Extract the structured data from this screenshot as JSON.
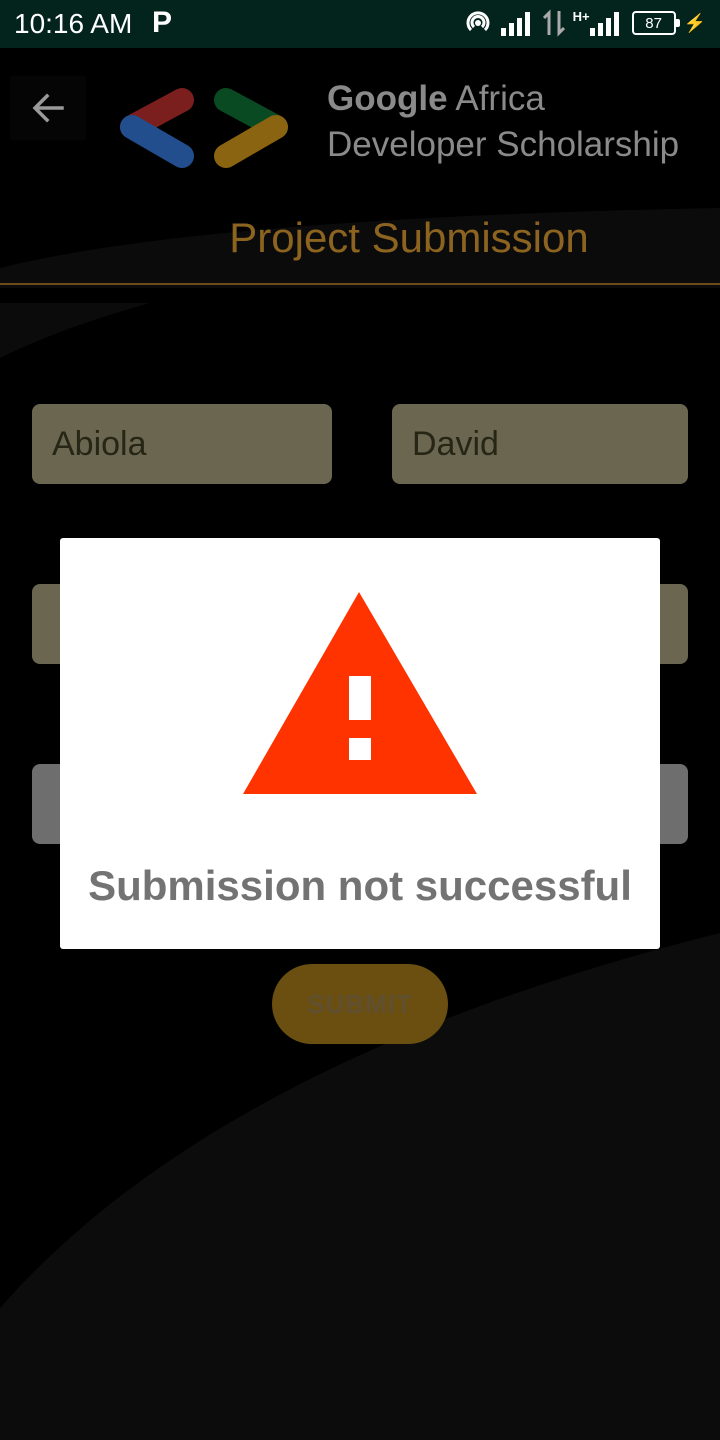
{
  "status_bar": {
    "time": "10:16 AM",
    "notification_icon": "p-icon",
    "network_label": "H+",
    "battery_level": "87"
  },
  "header": {
    "back_icon": "arrow-left-icon",
    "brand_line1_bold": "Google",
    "brand_line1_rest": " Africa",
    "brand_line2": "Developer Scholarship",
    "title": "Project Submission"
  },
  "form": {
    "first_name": "Abiola",
    "last_name": "David",
    "submit_label": "SUBMIT"
  },
  "dialog": {
    "icon": "warning-icon",
    "message": "Submission not successful"
  },
  "colors": {
    "status_bar": "#03241c",
    "accent": "#8c6420",
    "warning": "#ff3300"
  }
}
